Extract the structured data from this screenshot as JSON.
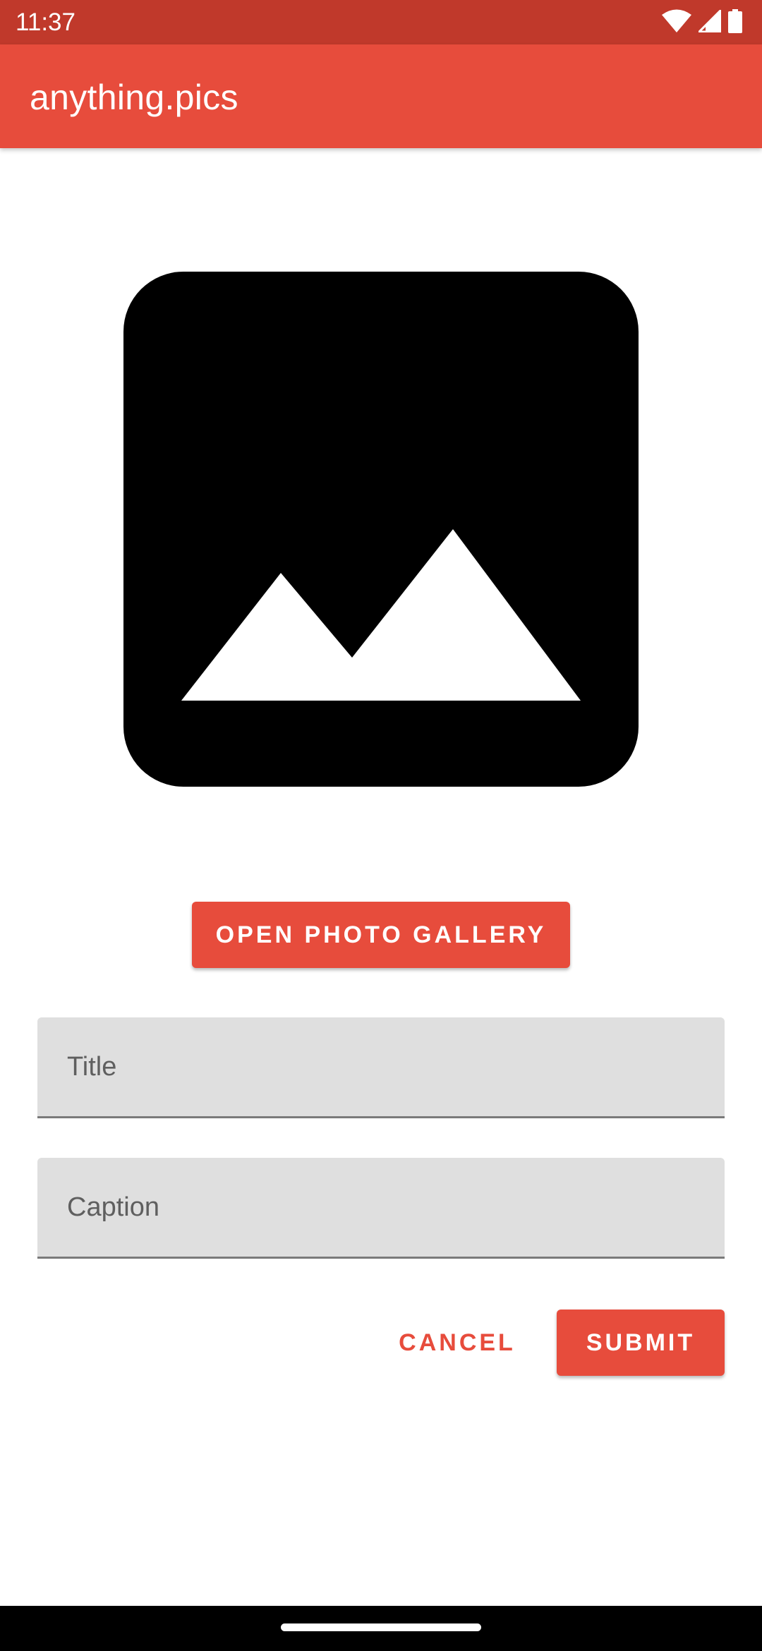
{
  "status_bar": {
    "time": "11:37",
    "icons": [
      "wifi-icon",
      "cell-signal-icon",
      "battery-icon"
    ],
    "color": "#c0392b"
  },
  "app_bar": {
    "title": "anything.pics",
    "color": "#e74c3c"
  },
  "image_preview": {
    "icon": "image-placeholder-icon"
  },
  "gallery_button": {
    "label": "OPEN PHOTO GALLERY"
  },
  "form": {
    "title_field": {
      "placeholder": "Title",
      "value": ""
    },
    "caption_field": {
      "placeholder": "Caption",
      "value": ""
    }
  },
  "actions": {
    "cancel_label": "CANCEL",
    "submit_label": "SUBMIT"
  },
  "nav_bar": {
    "handle": "home-handle"
  }
}
